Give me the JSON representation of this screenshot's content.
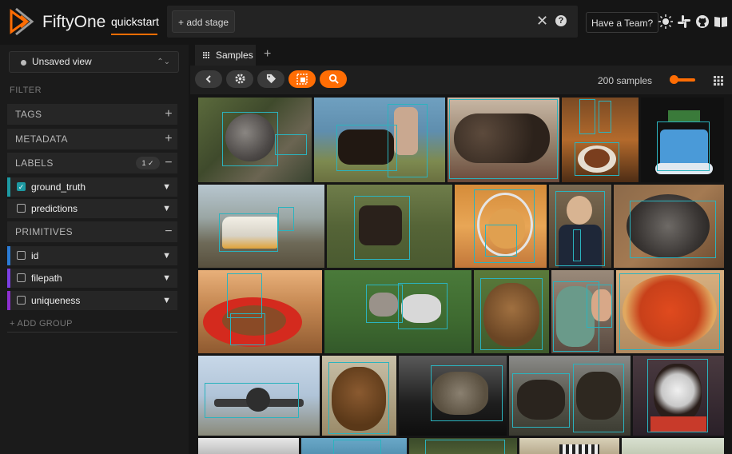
{
  "app": {
    "brand": "FiftyOne",
    "dataset": "quickstart"
  },
  "stage_bar": {
    "add_stage": "+ add stage",
    "clear": "✕",
    "help": "?"
  },
  "header": {
    "team_button": "Have a Team?"
  },
  "sidebar": {
    "view_selector": "Unsaved view",
    "filter_label": "FILTER",
    "sections": {
      "tags": "TAGS",
      "metadata": "METADATA",
      "labels": "LABELS",
      "labels_badge": "1 ✓",
      "primitives": "PRIMITIVES"
    },
    "label_fields": [
      {
        "name": "ground_truth",
        "checked": true,
        "color": "#1d9aa3"
      },
      {
        "name": "predictions",
        "checked": false,
        "color": "#262626"
      }
    ],
    "primitive_fields": [
      {
        "name": "id",
        "color": "#2b7bd5"
      },
      {
        "name": "filepath",
        "color": "#7b3fe4"
      },
      {
        "name": "uniqueness",
        "color": "#8d2fd0"
      }
    ],
    "add_group": "+ ADD GROUP"
  },
  "tabs": {
    "samples": "Samples",
    "add": "+"
  },
  "toolbar": {
    "sample_count": "200 samples"
  },
  "colors": {
    "accent": "#ff6d04",
    "box": "#2bb3be"
  },
  "gallery_label": "Sample grid of photos with ground_truth bounding boxes"
}
